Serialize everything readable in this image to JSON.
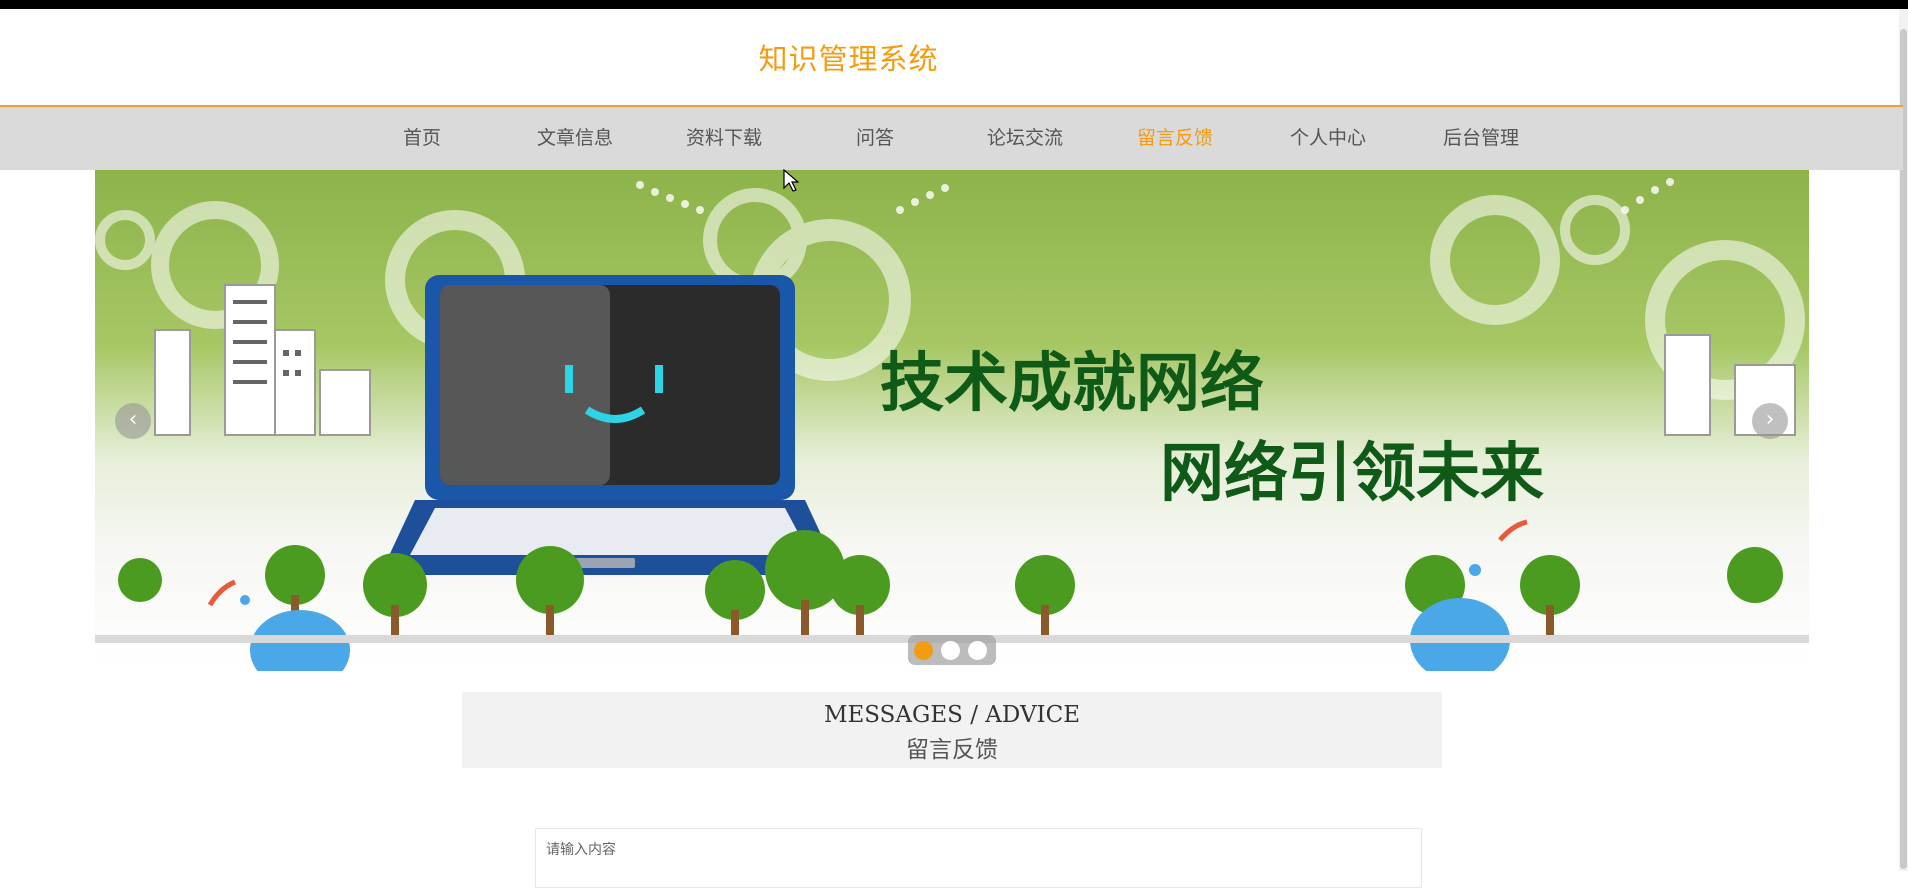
{
  "header": {
    "title": "知识管理系统"
  },
  "nav": {
    "items": [
      {
        "label": "首页",
        "active": false
      },
      {
        "label": "文章信息",
        "active": false
      },
      {
        "label": "资料下载",
        "active": false
      },
      {
        "label": "问答",
        "active": false
      },
      {
        "label": "论坛交流",
        "active": false
      },
      {
        "label": "留言反馈",
        "active": true
      },
      {
        "label": "个人中心",
        "active": false
      },
      {
        "label": "后台管理",
        "active": false
      }
    ]
  },
  "banner": {
    "line1": "技术成就网络",
    "line2": "网络引领未来",
    "prev_icon": "chevron-left-icon",
    "next_icon": "chevron-right-icon",
    "slide_count": 3,
    "active_slide": 1
  },
  "section": {
    "title_en": "MESSAGES / ADVICE",
    "title_cn": "留言反馈"
  },
  "form": {
    "placeholder": "请输入内容",
    "value": ""
  },
  "colors": {
    "accent": "#f39c12",
    "nav_bg": "#dadada",
    "section_bg": "#f2f2f2",
    "text": "#555555"
  }
}
